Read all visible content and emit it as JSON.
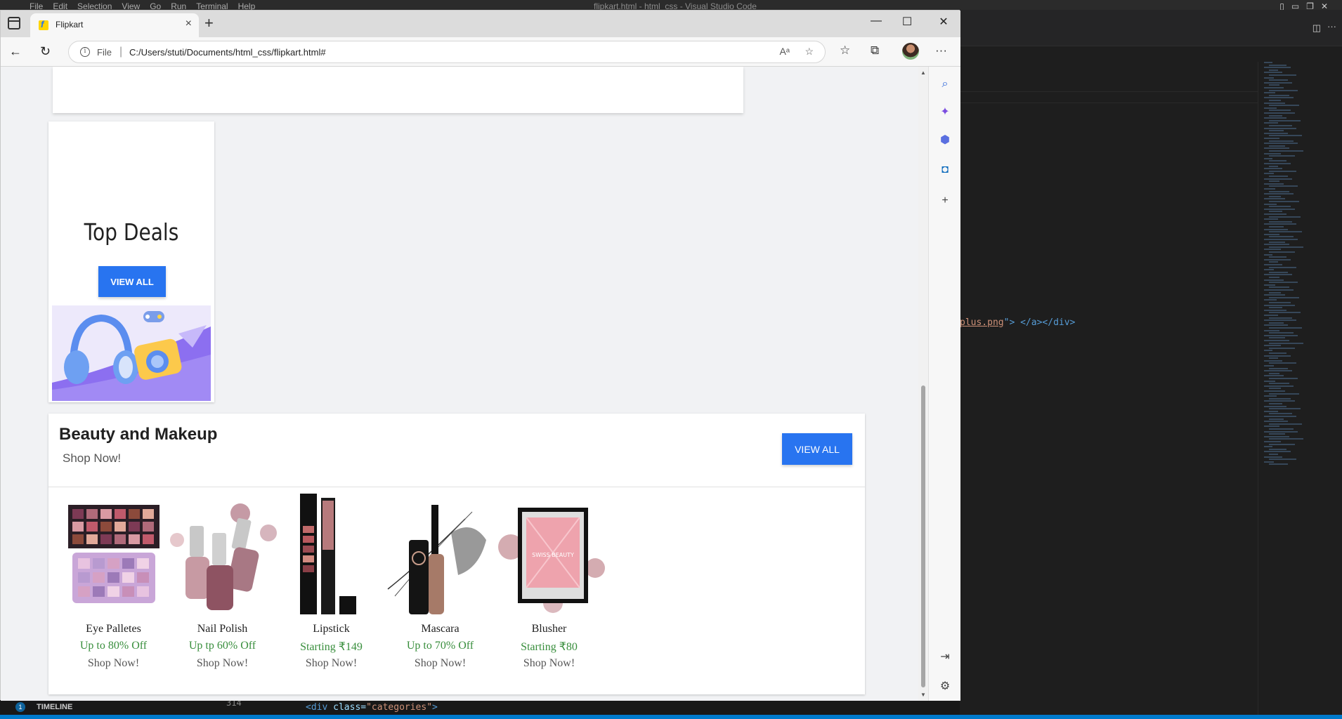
{
  "vscode": {
    "menu": [
      "File",
      "Edit",
      "Selection",
      "View",
      "Go",
      "Run",
      "Terminal",
      "Help"
    ],
    "title": "flipkart.html - html_css - Visual Studio Code",
    "code_line": {
      "plain_start": "",
      "string": "plus.png",
      "rest": "\"> </a></div>"
    },
    "timeline_label": "TIMELINE",
    "badge": "1",
    "bottom_line_number": "314",
    "bottom_code": {
      "tag": "<div",
      "attr": " class=",
      "value": "\"categories\"",
      "end": ">"
    }
  },
  "browser": {
    "tab_title": "Flipkart",
    "new_tab": "+",
    "address": {
      "scheme_label": "File",
      "path": "C:/Users/stuti/Documents/html_css/flipkart.html#"
    },
    "controls": {
      "minimize": "—",
      "maximize": "☐",
      "close": "✕"
    }
  },
  "page": {
    "top_deals": {
      "title": "Top Deals",
      "button": "VIEW ALL"
    },
    "beauty": {
      "title": "Beauty and Makeup",
      "subtitle": "Shop Now!",
      "button": "VIEW ALL",
      "products": [
        {
          "name": "Eye Palletes",
          "offer": "Up to 80% Off",
          "cta": "Shop Now!"
        },
        {
          "name": "Nail Polish",
          "offer": "Up tp 60% Off",
          "cta": "Shop Now!"
        },
        {
          "name": "Lipstick",
          "offer": "Starting ₹149",
          "cta": "Shop Now!"
        },
        {
          "name": "Mascara",
          "offer": "Up to 70% Off",
          "cta": "Shop Now!"
        },
        {
          "name": "Blusher",
          "offer": "Starting ₹80",
          "cta": "Shop Now!"
        }
      ]
    }
  },
  "colors": {
    "brand_blue": "#2874f0",
    "offer_green": "#388e3c",
    "page_bg": "#f1f2f4"
  }
}
